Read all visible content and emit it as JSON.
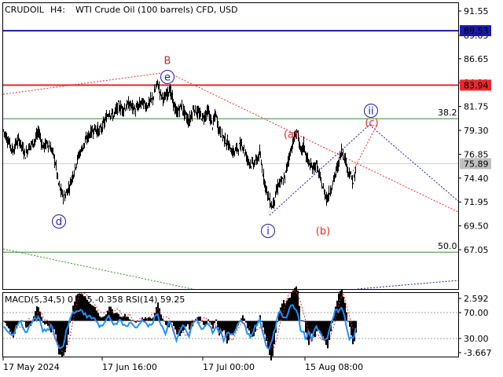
{
  "header": {
    "symbol": "CRUDOIL",
    "timeframe": "H4:",
    "description": "WTI Crude Oil (100 barrels) CFD, USD"
  },
  "price_axis": {
    "labels": [
      "91.55",
      "89.05",
      "86.65",
      "84.20",
      "81.75",
      "79.30",
      "76.85",
      "74.40",
      "71.95",
      "69.50",
      "67.05"
    ],
    "markers": [
      {
        "label": "89.53",
        "value": 89.53,
        "color": "#1a1aa8"
      },
      {
        "label": "83.94",
        "value": 83.94,
        "color": "#e8282d"
      },
      {
        "label": "75.89",
        "value": 75.89,
        "color": "#c0c0c0"
      }
    ]
  },
  "indicator": {
    "label": "MACD(5,34,5) 0.075 -0.358 RSI(14) 59.25",
    "axis_labels": [
      "2.592",
      "70.00",
      "30.00",
      "-3.667"
    ]
  },
  "time_axis": {
    "labels": [
      "17 May 2024",
      "17 Jun 16:00",
      "17 Jul 00:00",
      "15 Aug 08:00"
    ]
  },
  "levels": {
    "blue_line": 89.53,
    "red_line": 83.94,
    "fib_382": {
      "label": "38.2",
      "value": 80.5
    },
    "fib_50": {
      "label": "50.0",
      "value": 66.8
    }
  },
  "wave_labels": [
    {
      "text": "B",
      "color": "#c0282d",
      "circle": false
    },
    {
      "text": "e",
      "color": "#1a1aa8",
      "circle": true
    },
    {
      "text": "d",
      "color": "#1a1aa8",
      "circle": true
    },
    {
      "text": "i",
      "color": "#1a1aa8",
      "circle": true
    },
    {
      "text": "(a)",
      "color": "#e8282d",
      "circle": false
    },
    {
      "text": "(b)",
      "color": "#e8282d",
      "circle": false
    },
    {
      "text": "(c)",
      "color": "#e8282d",
      "circle": false
    },
    {
      "text": "ii",
      "color": "#1a1aa8",
      "circle": true
    }
  ],
  "colors": {
    "candles": "#000000",
    "blue_level": "#1a1aa8",
    "red_level": "#e8282d",
    "fib": "#2e8b2e",
    "rsi": "#1e90ff",
    "macd_signal": "#e8282d"
  },
  "chart_data": {
    "type": "candlestick",
    "symbol": "CRUDOIL",
    "timeframe": "H4",
    "x_labels": [
      "17 May 2024",
      "17 Jun 16:00",
      "17 Jul 00:00",
      "15 Aug 08:00"
    ],
    "price_range": [
      65.5,
      93.0
    ],
    "path_knots": [
      [
        0,
        79.3
      ],
      [
        4,
        78.6
      ],
      [
        8,
        77.9
      ],
      [
        12,
        77.2
      ],
      [
        16,
        78.0
      ],
      [
        20,
        78.3
      ],
      [
        24,
        77.5
      ],
      [
        28,
        76.8
      ],
      [
        32,
        77.6
      ],
      [
        36,
        77.9
      ],
      [
        40,
        78.3
      ],
      [
        45,
        79.2
      ],
      [
        50,
        77.6
      ],
      [
        56,
        78.0
      ],
      [
        62,
        77.2
      ],
      [
        66,
        76.0
      ],
      [
        70,
        73.8
      ],
      [
        74,
        72.8
      ],
      [
        78,
        72.5
      ],
      [
        84,
        73.6
      ],
      [
        90,
        75.2
      ],
      [
        96,
        76.8
      ],
      [
        102,
        77.8
      ],
      [
        110,
        79.0
      ],
      [
        116,
        79.5
      ],
      [
        122,
        79.2
      ],
      [
        128,
        80.0
      ],
      [
        134,
        81.2
      ],
      [
        140,
        80.8
      ],
      [
        146,
        81.8
      ],
      [
        152,
        81.5
      ],
      [
        160,
        82.0
      ],
      [
        168,
        81.4
      ],
      [
        176,
        82.2
      ],
      [
        182,
        81.8
      ],
      [
        190,
        82.6
      ],
      [
        196,
        84.2
      ],
      [
        200,
        83.0
      ],
      [
        205,
        82.5
      ],
      [
        211,
        83.6
      ],
      [
        216,
        82.2
      ],
      [
        220,
        81.0
      ],
      [
        226,
        81.8
      ],
      [
        232,
        80.8
      ],
      [
        236,
        80.2
      ],
      [
        242,
        81.6
      ],
      [
        248,
        81.0
      ],
      [
        254,
        80.6
      ],
      [
        260,
        81.3
      ],
      [
        266,
        79.8
      ],
      [
        270,
        81.0
      ],
      [
        274,
        79.4
      ],
      [
        280,
        78.6
      ],
      [
        286,
        77.8
      ],
      [
        292,
        77.0
      ],
      [
        298,
        77.5
      ],
      [
        304,
        77.9
      ],
      [
        310,
        76.4
      ],
      [
        316,
        75.8
      ],
      [
        322,
        76.2
      ],
      [
        326,
        76.9
      ],
      [
        330,
        75.0
      ],
      [
        334,
        73.4
      ],
      [
        338,
        72.2
      ],
      [
        342,
        71.5
      ],
      [
        346,
        72.6
      ],
      [
        350,
        73.8
      ],
      [
        354,
        74.0
      ],
      [
        358,
        74.4
      ],
      [
        362,
        76.2
      ],
      [
        366,
        77.4
      ],
      [
        370,
        78.5
      ],
      [
        374,
        79.2
      ],
      [
        378,
        77.0
      ],
      [
        382,
        77.8
      ],
      [
        386,
        76.4
      ],
      [
        392,
        75.4
      ],
      [
        398,
        75.8
      ],
      [
        404,
        74.0
      ],
      [
        408,
        73.0
      ],
      [
        412,
        72.3
      ],
      [
        416,
        73.2
      ],
      [
        420,
        74.2
      ],
      [
        426,
        75.8
      ],
      [
        430,
        77.2
      ],
      [
        434,
        76.6
      ],
      [
        438,
        75.3
      ],
      [
        442,
        74.6
      ],
      [
        445,
        73.9
      ],
      [
        448,
        75.0
      ]
    ],
    "levels": [
      {
        "name": "blue resistance",
        "value": 89.53
      },
      {
        "name": "red resistance",
        "value": 83.94
      },
      {
        "name": "current",
        "value": 75.89
      },
      {
        "name": "fib 38.2",
        "value": 80.5
      },
      {
        "name": "fib 50.0",
        "value": 66.8
      }
    ],
    "indicator": {
      "macd_params": [
        5,
        34,
        5
      ],
      "macd_value": 0.075,
      "signal_value": -0.358,
      "rsi_period": 14,
      "rsi_value": 59.25,
      "axis_range": [
        -3.667,
        2.592
      ],
      "rsi_levels": [
        70.0,
        30.0
      ]
    }
  }
}
